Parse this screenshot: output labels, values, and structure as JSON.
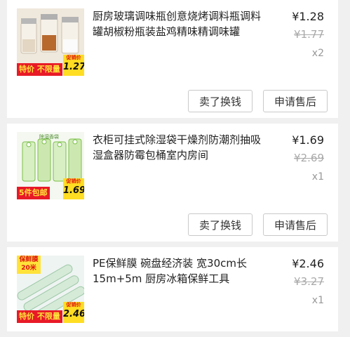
{
  "orders": [
    {
      "title": "厨房玻璃调味瓶创意烧烤调料瓶调料罐胡椒粉瓶装盐鸡精味精调味罐",
      "price": "¥1.28",
      "original_price": "¥1.77",
      "quantity": "x2",
      "badge_left": "特价 不限量",
      "badge_right_label": "促销价",
      "badge_right_value": "1.27",
      "actions": {
        "sell": "卖了换钱",
        "after_sale": "申请售后"
      }
    },
    {
      "title": "衣柜可挂式除湿袋干燥剂防潮剂抽吸湿盒器防霉包桶室内房间",
      "price": "¥1.69",
      "original_price": "¥2.69",
      "quantity": "x1",
      "brand_tag": "除湿香袋",
      "badge_left": "5件包邮",
      "badge_right_label": "促销价",
      "badge_right_value": "1.69",
      "actions": {
        "sell": "卖了换钱",
        "after_sale": "申请售后"
      }
    },
    {
      "title": "PE保鲜膜 碗盘经济装 宽30cm长15m+5m 厨房冰箱保鲜工具",
      "price": "¥2.46",
      "original_price": "¥3.27",
      "quantity": "x1",
      "wrap_tag": "保鲜膜 20米",
      "badge_left": "特价 不限量",
      "badge_right_label": "促销价",
      "badge_right_value": "2.46"
    }
  ],
  "colors": {
    "background": "#f0f0f0",
    "card": "#ffffff",
    "badge_red": "#e81a27",
    "badge_yellow": "#ffdd22",
    "strike_gray": "#a9a9a9"
  }
}
